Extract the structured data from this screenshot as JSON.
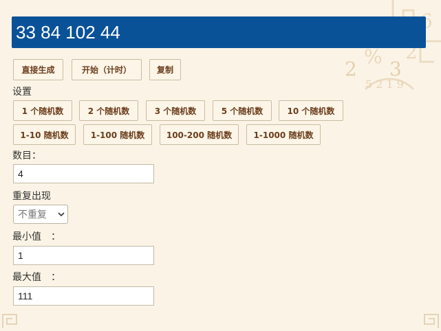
{
  "result": {
    "value": "33 84 102 44"
  },
  "actions": {
    "generate_label": "直接生成",
    "start_label": "开始（计时）",
    "copy_label": "复制"
  },
  "settings": {
    "title": "设置",
    "presets_count": [
      "1 个随机数",
      "2 个随机数",
      "3 个随机数",
      "5 个随机数",
      "10 个随机数"
    ],
    "presets_range": [
      "1-10 随机数",
      "1-100 随机数",
      "100-200 随机数",
      "1-1000 随机数"
    ]
  },
  "form": {
    "count_label": "数目：",
    "count_value": "4",
    "repeat_label": "重复出现",
    "repeat_selected": "不重复",
    "min_label": "最小值　：",
    "min_value": "1",
    "max_label": "最大值　：",
    "max_value": "111"
  },
  "colors": {
    "result_bg": "#0a5298",
    "page_bg": "#fbf4e6",
    "button_text": "#6b3e1d"
  },
  "icons": {
    "select_arrow": "chevron-down-icon"
  }
}
